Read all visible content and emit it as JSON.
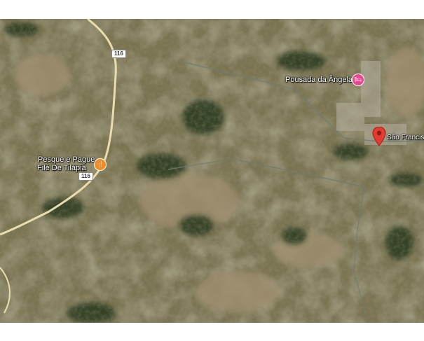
{
  "map": {
    "type": "satellite",
    "colors": {
      "road": "#e9dcaf",
      "lodging_pin": "#e8488f",
      "food_pin": "#f28c1e",
      "place_pin": "#e03c31"
    },
    "roads": [
      {
        "shield": "116"
      },
      {
        "shield": "116"
      }
    ],
    "places": [
      {
        "name": "Pousada da Ângela",
        "icon": "hotel-bed-icon",
        "icon_glyph": "🛏"
      },
      {
        "line1": "Pesque e Pague",
        "line2": "Filé De Tilápia",
        "icon": "fork-knife-icon",
        "icon_glyph": "🍴"
      },
      {
        "name": "São Francis",
        "icon": "location-pin-icon"
      }
    ]
  }
}
